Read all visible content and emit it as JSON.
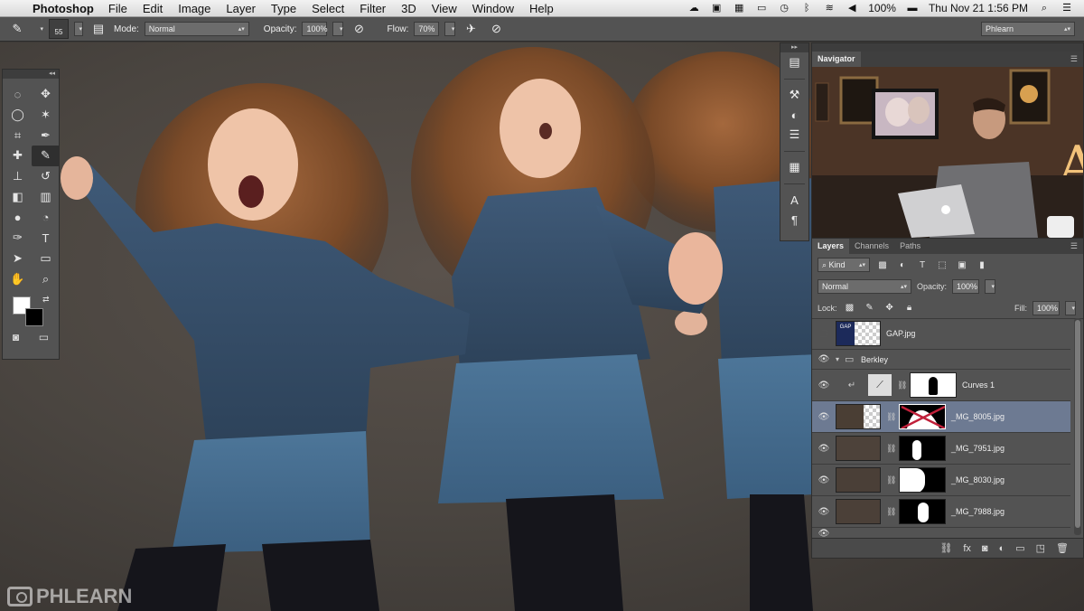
{
  "menubar": {
    "app_name": "Photoshop",
    "items": [
      "File",
      "Edit",
      "Image",
      "Layer",
      "Type",
      "Select",
      "Filter",
      "3D",
      "View",
      "Window",
      "Help"
    ],
    "battery": "100%",
    "clock": "Thu Nov 21  1:56 PM"
  },
  "options_bar": {
    "brush_size": "55",
    "mode_label": "Mode:",
    "mode_value": "Normal",
    "opacity_label": "Opacity:",
    "opacity_value": "100%",
    "flow_label": "Flow:",
    "flow_value": "70%",
    "workspace": "Phlearn"
  },
  "navigator": {
    "title": "Navigator"
  },
  "layers_panel": {
    "tabs": [
      "Layers",
      "Channels",
      "Paths"
    ],
    "filter_label": "Kind",
    "blend_mode": "Normal",
    "opacity_label": "Opacity:",
    "opacity_value": "100%",
    "lock_label": "Lock:",
    "fill_label": "Fill:",
    "fill_value": "100%",
    "layers": [
      {
        "name": "GAP.jpg",
        "visible": false
      },
      {
        "name": "Berkley",
        "visible": true
      },
      {
        "name": "Curves 1",
        "visible": true
      },
      {
        "name": "_MG_8005.jpg",
        "visible": true
      },
      {
        "name": "_MG_7951.jpg",
        "visible": true
      },
      {
        "name": "_MG_8030.jpg",
        "visible": true
      },
      {
        "name": "_MG_7988.jpg",
        "visible": true
      }
    ]
  },
  "watermark": {
    "text": "PHLEARN"
  },
  "colors": {
    "foreground": "#ffffff",
    "background": "#000000",
    "selected_layer": "#6d7a92",
    "panel": "#535353"
  }
}
